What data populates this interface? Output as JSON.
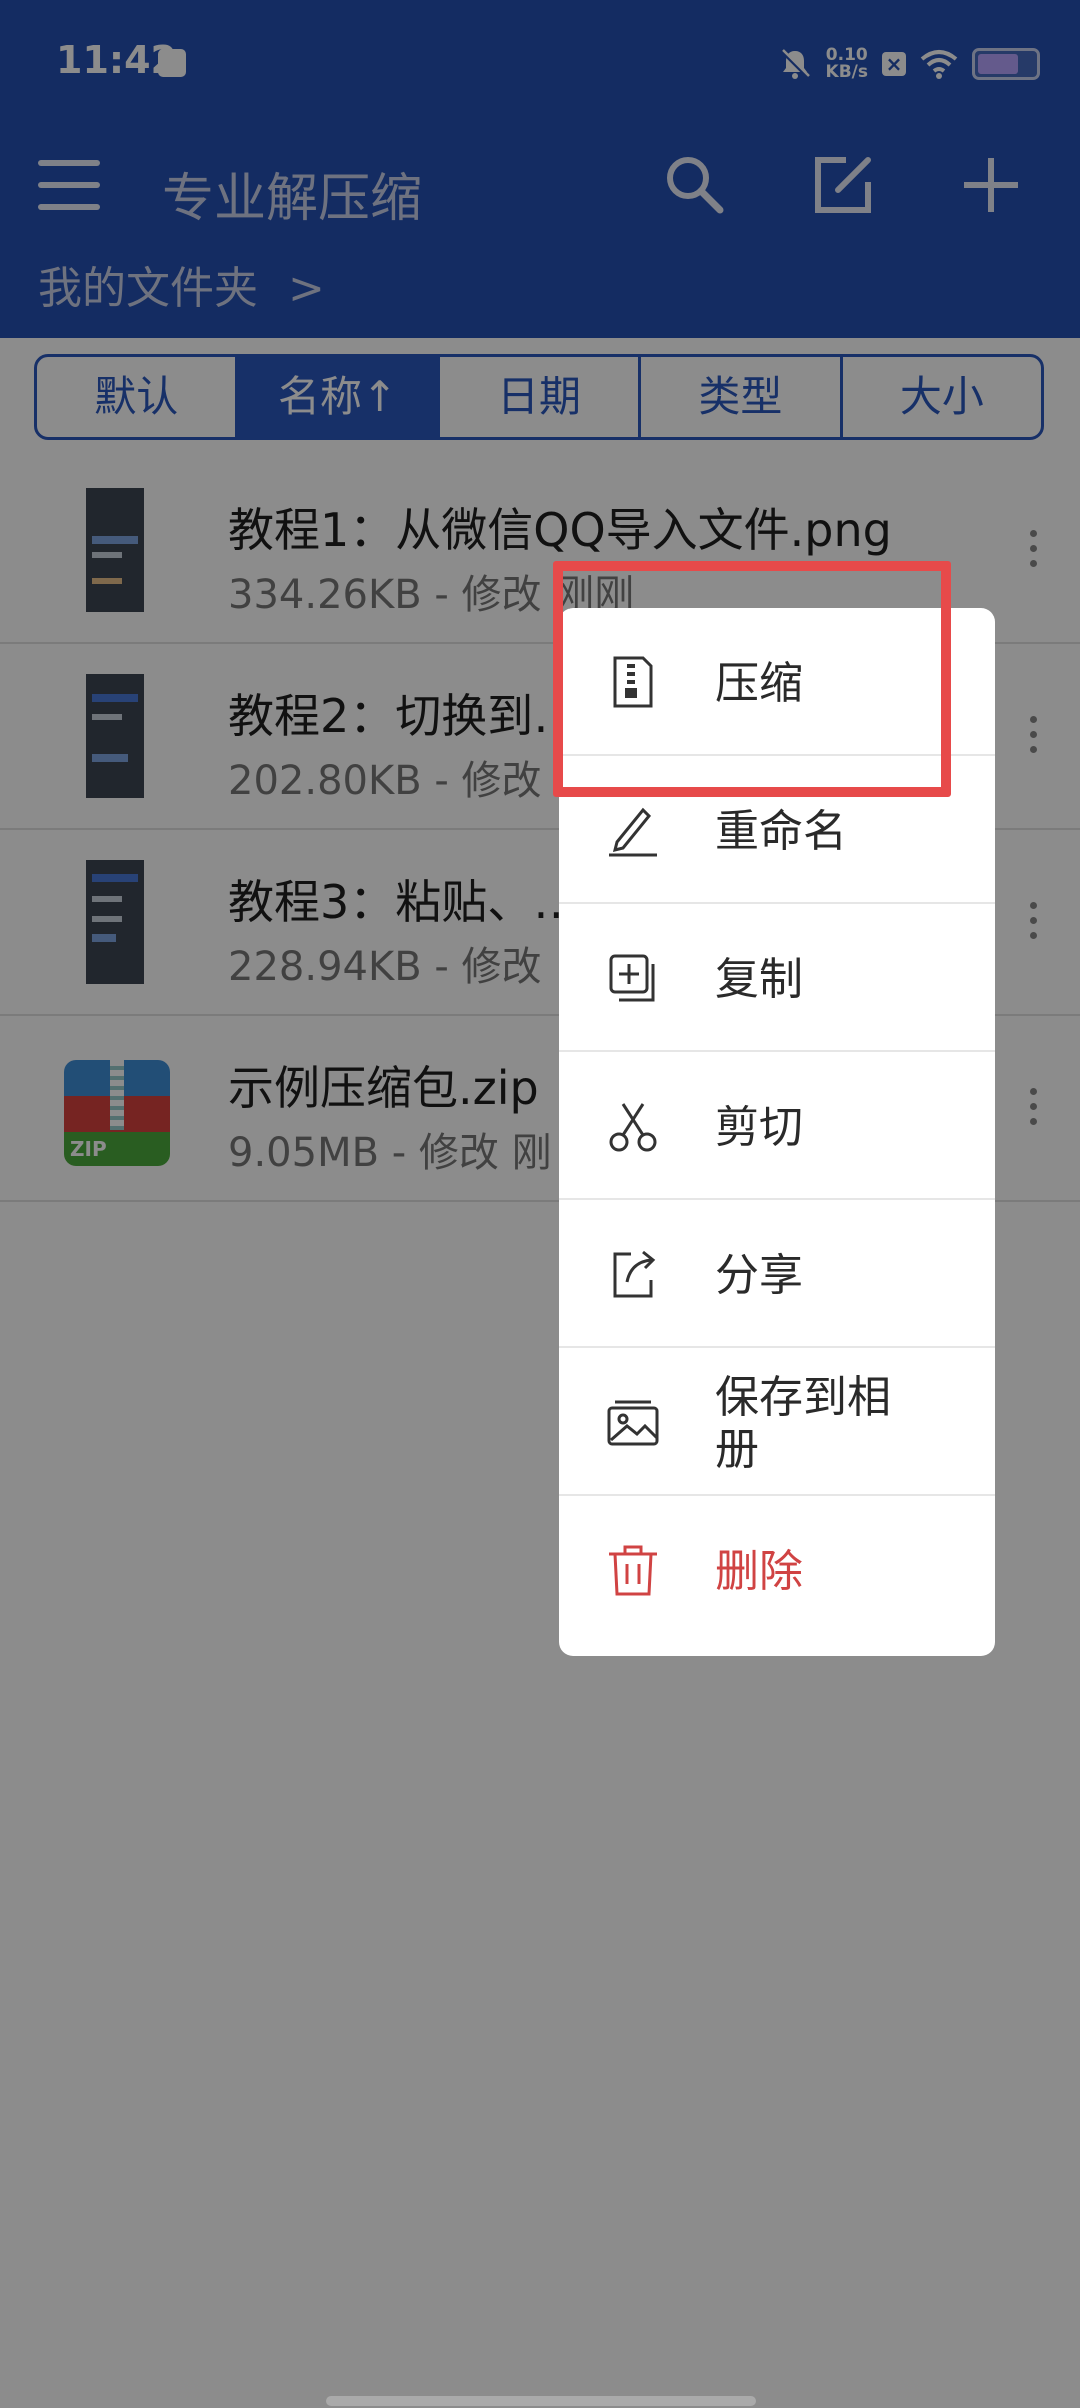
{
  "status_bar": {
    "time": "11:42",
    "net_speed_value": "0.10",
    "net_speed_unit": "KB/s"
  },
  "toolbar": {
    "title": "专业解压缩"
  },
  "breadcrumb": {
    "label": "我的文件夹",
    "chevron": ">"
  },
  "sort_tabs": [
    {
      "label": "默认",
      "active": false
    },
    {
      "label": "名称↑",
      "active": true
    },
    {
      "label": "日期",
      "active": false
    },
    {
      "label": "类型",
      "active": false
    },
    {
      "label": "大小",
      "active": false
    }
  ],
  "files": [
    {
      "name": "教程1：从微信QQ导入文件.png",
      "meta": "334.26KB - 修改 刚刚",
      "icon": "image-thumbnail"
    },
    {
      "name": "教程2：切换到…",
      "meta": "202.80KB - 修改",
      "icon": "image-thumbnail"
    },
    {
      "name": "教程3：粘贴、…",
      "meta": "228.94KB - 修改",
      "icon": "image-thumbnail"
    },
    {
      "name": "示例压缩包.zip",
      "meta": "9.05MB - 修改 刚",
      "icon": "zip-file-icon",
      "zip_badge": "ZIP"
    }
  ],
  "context_menu": {
    "items": [
      {
        "label": "压缩",
        "icon": "compress-file-icon"
      },
      {
        "label": "重命名",
        "icon": "rename-pen-icon"
      },
      {
        "label": "复制",
        "icon": "copy-icon"
      },
      {
        "label": "剪切",
        "icon": "scissors-icon"
      },
      {
        "label": "分享",
        "icon": "share-icon"
      },
      {
        "label": "保存到相册",
        "icon": "save-to-album-icon"
      },
      {
        "label": "删除",
        "icon": "trash-icon",
        "color": "#d04343"
      }
    ]
  },
  "colors": {
    "header": "#2550b2",
    "accent": "#2a58be",
    "highlight": "#e74a4a",
    "delete": "#d04343"
  }
}
